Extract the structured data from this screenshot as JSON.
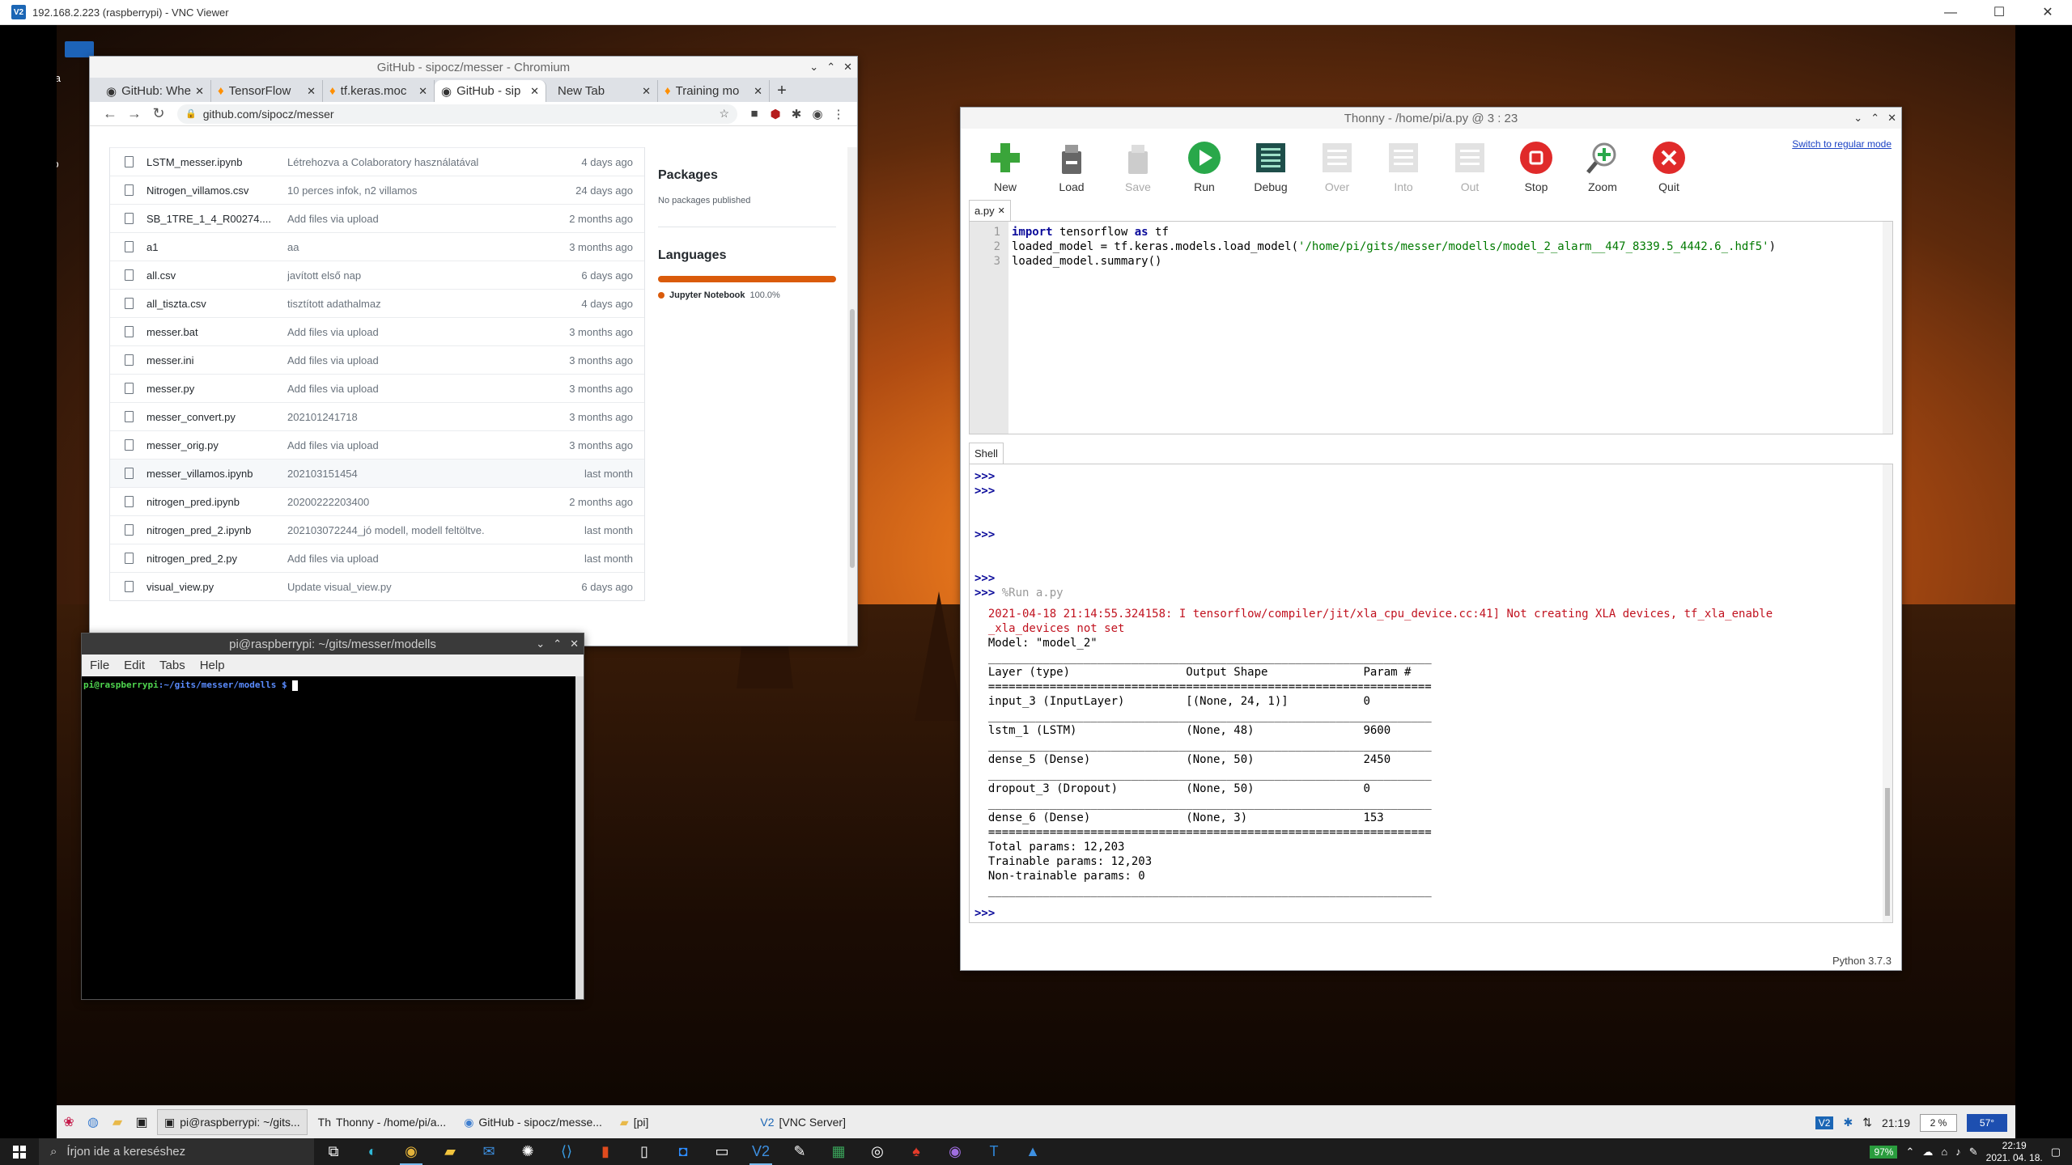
{
  "vnc": {
    "title": "192.168.2.223 (raspberrypi) - VNC Viewer",
    "controls": [
      "—",
      "☐",
      "✕"
    ]
  },
  "desktop_icons": [
    "Wa",
    "Co"
  ],
  "chromium": {
    "title": "GitHub - sipocz/messer - Chromium",
    "tabs": [
      {
        "label": "GitHub: Whe",
        "icon": "github-icon"
      },
      {
        "label": "TensorFlow",
        "icon": "tensorflow-icon"
      },
      {
        "label": "tf.keras.moc",
        "icon": "tensorflow-icon"
      },
      {
        "label": "GitHub - sip",
        "icon": "github-icon",
        "active": true
      },
      {
        "label": "New Tab",
        "icon": ""
      },
      {
        "label": "Training mo",
        "icon": "tensorflow-icon"
      }
    ],
    "url": "github.com/sipocz/messer",
    "files": [
      {
        "name": "LSTM_messer.ipynb",
        "msg": "Létrehozva a Colaboratory használatával",
        "age": "4 days ago"
      },
      {
        "name": "Nitrogen_villamos.csv",
        "msg": "10 perces infok, n2 villamos",
        "age": "24 days ago"
      },
      {
        "name": "SB_1TRE_1_4_R00274....",
        "msg": "Add files via upload",
        "age": "2 months ago"
      },
      {
        "name": "a1",
        "msg": "aa",
        "age": "3 months ago"
      },
      {
        "name": "all.csv",
        "msg": "javított első nap",
        "age": "6 days ago"
      },
      {
        "name": "all_tiszta.csv",
        "msg": "tisztított adathalmaz",
        "age": "4 days ago"
      },
      {
        "name": "messer.bat",
        "msg": "Add files via upload",
        "age": "3 months ago"
      },
      {
        "name": "messer.ini",
        "msg": "Add files via upload",
        "age": "3 months ago"
      },
      {
        "name": "messer.py",
        "msg": "Add files via upload",
        "age": "3 months ago"
      },
      {
        "name": "messer_convert.py",
        "msg": "202101241718",
        "age": "3 months ago"
      },
      {
        "name": "messer_orig.py",
        "msg": "Add files via upload",
        "age": "3 months ago"
      },
      {
        "name": "messer_villamos.ipynb",
        "msg": "202103151454",
        "age": "last month",
        "highlight": true
      },
      {
        "name": "nitrogen_pred.ipynb",
        "msg": "20200222203400",
        "age": "2 months ago"
      },
      {
        "name": "nitrogen_pred_2.ipynb",
        "msg": "202103072244_jó modell, modell feltöltve.",
        "age": "last month"
      },
      {
        "name": "nitrogen_pred_2.py",
        "msg": "Add files via upload",
        "age": "last month"
      },
      {
        "name": "visual_view.py",
        "msg": "Update visual_view.py",
        "age": "6 days ago"
      }
    ],
    "sidebar": {
      "packages_heading": "Packages",
      "packages_text": "No packages published",
      "languages_heading": "Languages",
      "language_name": "Jupyter Notebook",
      "language_pct": "100.0%"
    }
  },
  "terminal": {
    "title": "pi@raspberrypi: ~/gits/messer/modells",
    "menu": [
      "File",
      "Edit",
      "Tabs",
      "Help"
    ],
    "prompt_user": "pi@raspberrypi",
    "prompt_path": ":~/gits/messer/modells $ "
  },
  "thonny": {
    "title": "Thonny  -  /home/pi/a.py  @  3 : 23",
    "tools": [
      {
        "label": "New",
        "icon": "new-file-icon",
        "enabled": true
      },
      {
        "label": "Load",
        "icon": "load-icon",
        "enabled": true
      },
      {
        "label": "Save",
        "icon": "save-icon",
        "enabled": false
      },
      {
        "label": "Run",
        "icon": "run-icon",
        "enabled": true
      },
      {
        "label": "Debug",
        "icon": "debug-icon",
        "enabled": true
      },
      {
        "label": "Over",
        "icon": "step-over-icon",
        "enabled": false
      },
      {
        "label": "Into",
        "icon": "step-into-icon",
        "enabled": false
      },
      {
        "label": "Out",
        "icon": "step-out-icon",
        "enabled": false
      },
      {
        "label": "Stop",
        "icon": "stop-icon",
        "enabled": true
      },
      {
        "label": "Zoom",
        "icon": "zoom-icon",
        "enabled": true
      },
      {
        "label": "Quit",
        "icon": "quit-icon",
        "enabled": true
      }
    ],
    "switch_mode": "Switch to regular mode",
    "editor_tab": "a.py",
    "line_numbers": [
      "1",
      "2",
      "3"
    ],
    "code": {
      "l1_kw1": "import",
      "l1_mid": " tensorflow ",
      "l1_kw2": "as",
      "l1_end": " tf",
      "l2_pre": "loaded_model = tf.keras.models.load_model(",
      "l2_str": "'/home/pi/gits/messer/modells/model_2_alarm__447_8339.5_4442.6_.hdf5'",
      "l2_end": ")",
      "l3": "loaded_model.summary()"
    },
    "shell_tab": "Shell",
    "shell": {
      "prompt": ">>>",
      "run_cmd": " %Run a.py",
      "warn1": "2021-04-18 21:14:55.324158: I tensorflow/compiler/jit/xla_cpu_device.cc:41] Not creating XLA devices, tf_xla_enable",
      "warn2": "_xla_devices not set",
      "model_line": "Model: \"model_2\"",
      "rule1": "_________________________________________________________________",
      "header": "Layer (type)                 Output Shape              Param #",
      "rule_eq": "=================================================================",
      "rows": [
        "input_3 (InputLayer)         [(None, 24, 1)]           0",
        "lstm_1 (LSTM)                (None, 48)                9600",
        "dense_5 (Dense)              (None, 50)                2450",
        "dropout_3 (Dropout)          (None, 50)                0",
        "dense_6 (Dense)              (None, 3)                 153"
      ],
      "total": "Total params: 12,203",
      "trainable": "Trainable params: 12,203",
      "nontrainable": "Non-trainable params: 0"
    },
    "status": "Python 3.7.3"
  },
  "pipanel": {
    "tasks": [
      {
        "label": "pi@raspberrypi: ~/gits...",
        "active": true
      },
      {
        "label": "Thonny  -  /home/pi/a...",
        "active": false
      },
      {
        "label": "GitHub - sipocz/messe...",
        "active": false
      },
      {
        "label": "[pi]",
        "active": false
      },
      {
        "label": "[VNC Server]",
        "active": false
      }
    ],
    "time": "21:19",
    "cpu": "2 %",
    "temp": "57°"
  },
  "wintaskbar": {
    "search_placeholder": "Írjon ide a kereséshez",
    "battery": "97%",
    "time": "22:19",
    "date": "2021. 04. 18."
  }
}
